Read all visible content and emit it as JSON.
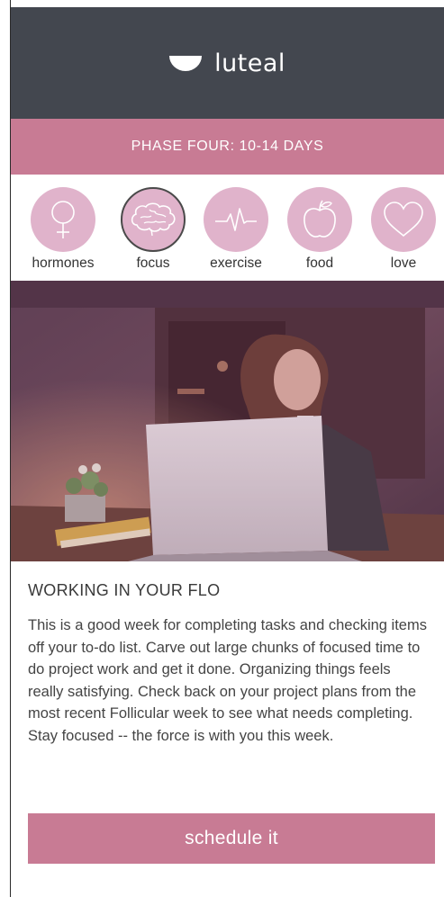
{
  "header": {
    "logo_icon": "half-moon-icon",
    "app_name": "luteal",
    "background_color": "#43474f"
  },
  "phase": {
    "label": "PHASE FOUR: 10-14 DAYS",
    "color": "#c87b94"
  },
  "categories": [
    {
      "label": "hormones",
      "icon": "venus-icon",
      "active": false
    },
    {
      "label": "focus",
      "icon": "brain-icon",
      "active": true
    },
    {
      "label": "exercise",
      "icon": "heartbeat-icon",
      "active": false
    },
    {
      "label": "food",
      "icon": "apple-icon",
      "active": false
    },
    {
      "label": "love",
      "icon": "heart-icon",
      "active": false
    }
  ],
  "category_circle_color": "#e0b3cb",
  "hero_image": {
    "description_icon": "woman-working-on-laptop-photo"
  },
  "article": {
    "title": "WORKING IN YOUR FLO",
    "body": "This is a good week for completing tasks and checking items off your to-do list. Carve out large chunks of focused time to do project work and get it done.  Organizing things feels really satisfying. Check back on your project plans from the most recent Follicular week to see what needs completing.  Stay focused -- the force is with you this week."
  },
  "cta": {
    "label": "schedule it",
    "color": "#c87b94"
  }
}
